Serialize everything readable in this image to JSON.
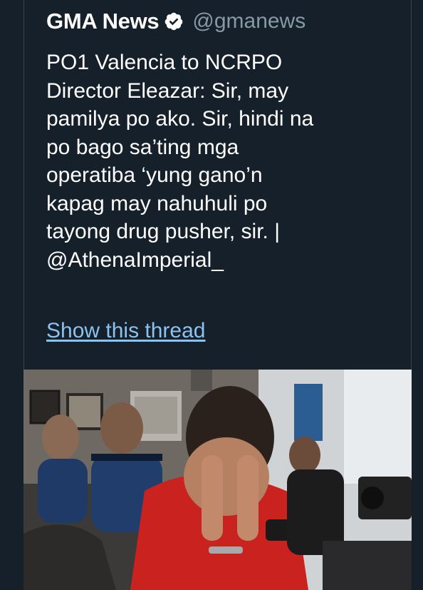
{
  "tweet": {
    "author_name": "GMA News",
    "handle": "@gmanews",
    "verified_icon": "verified-badge-icon",
    "text": "PO1 Valencia to NCRPO\nDirector Eleazar: Sir, may\npamilya po ako. Sir, hindi na\npo bago sa’ting mga\noperatiba ‘yung gano’n\nkapag may nahuhuli po\ntayong drug pusher, sir. |\n@AthenaImperial_",
    "show_thread_label": "Show this thread"
  },
  "colors": {
    "background": "#15202b",
    "text": "#ffffff",
    "handle": "#8899a6",
    "link": "#8ac3ef",
    "border": "#38444d"
  }
}
